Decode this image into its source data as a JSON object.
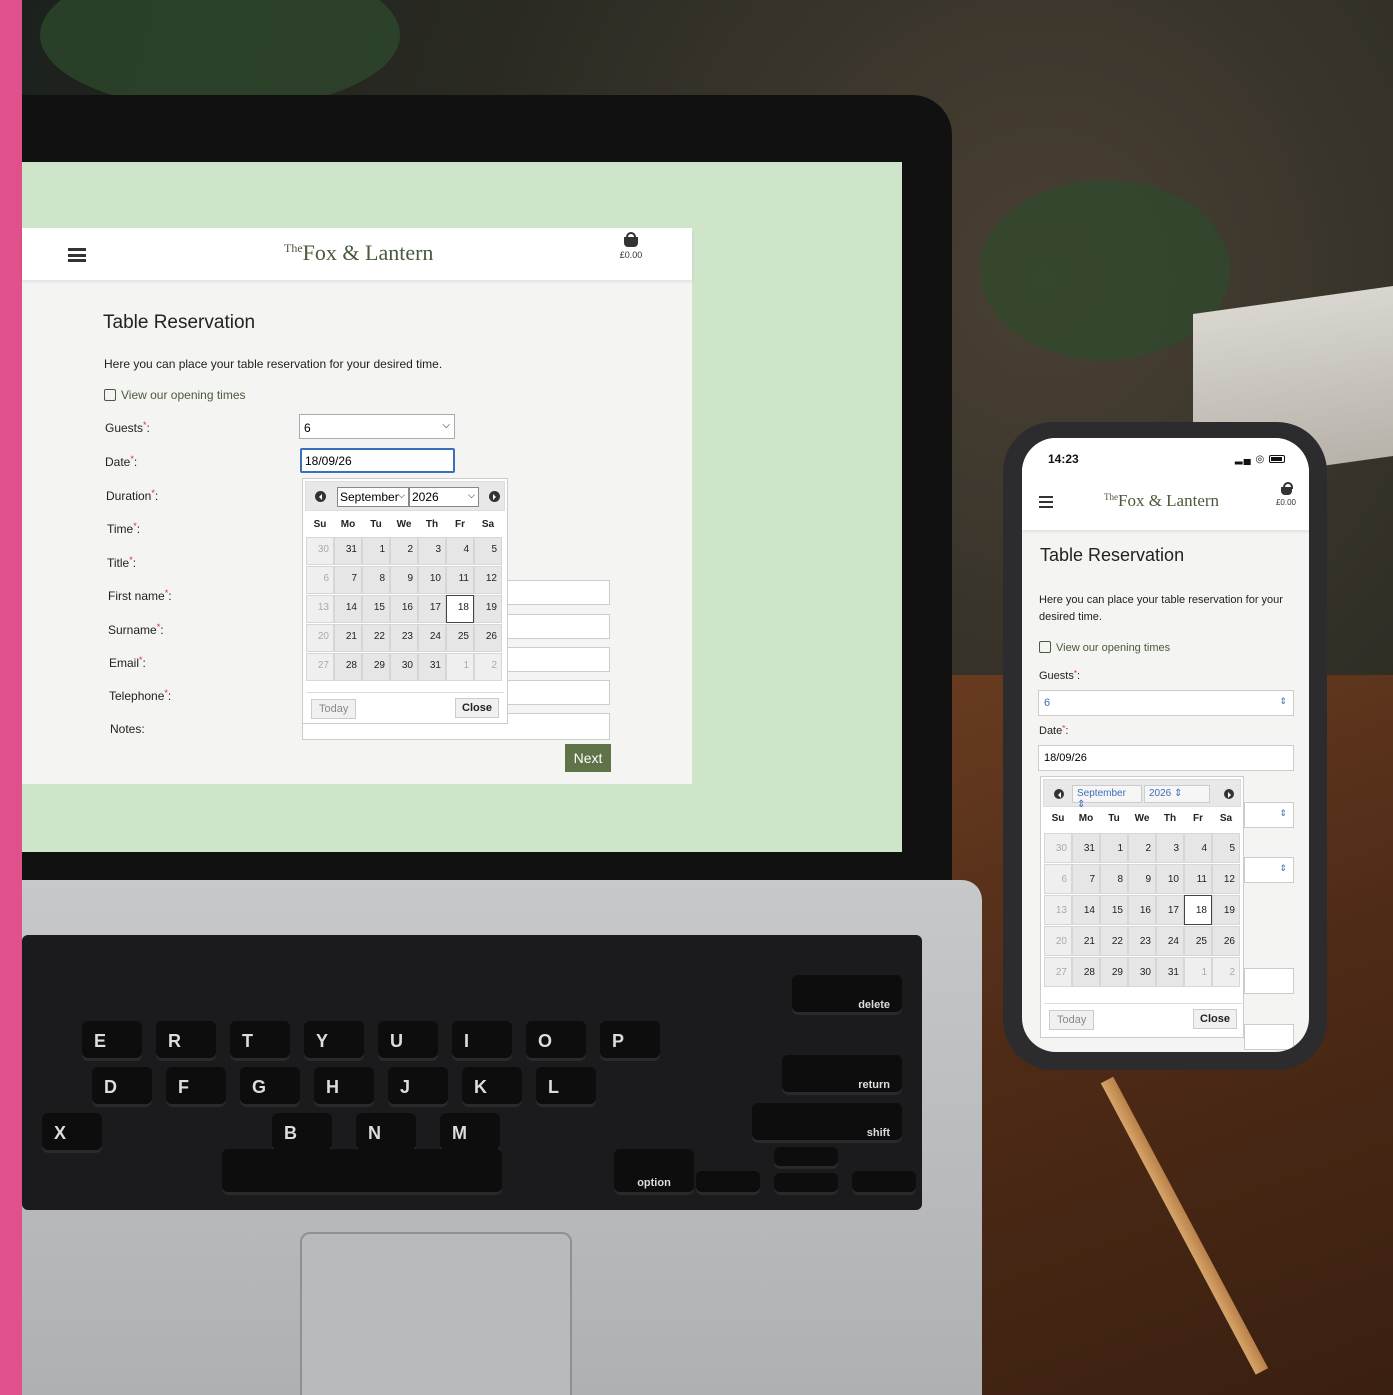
{
  "brand": {
    "the": "The",
    "name": "Fox & Lantern",
    "basket_total": "£0.00"
  },
  "page": {
    "title": "Table Reservation",
    "intro": "Here you can place your table reservation for your desired time.",
    "opening_link": "View our opening times",
    "next_label": "Next"
  },
  "form": {
    "guests_label": "Guests",
    "date_label": "Date",
    "duration_label": "Duration",
    "time_label": "Time",
    "title_label": "Title",
    "firstname_label": "First name",
    "surname_label": "Surname",
    "email_label": "Email",
    "telephone_label": "Telephone",
    "notes_label": "Notes:",
    "required_mark": "*",
    "colon": ":",
    "guests_value": "6",
    "date_value": "18/09/26"
  },
  "datepicker": {
    "month": "September",
    "year": "2026",
    "weekdays": [
      "Su",
      "Mo",
      "Tu",
      "We",
      "Th",
      "Fr",
      "Sa"
    ],
    "weeks": [
      [
        "30",
        "31",
        "1",
        "2",
        "3",
        "4",
        "5"
      ],
      [
        "6",
        "7",
        "8",
        "9",
        "10",
        "11",
        "12"
      ],
      [
        "13",
        "14",
        "15",
        "16",
        "17",
        "18",
        "19"
      ],
      [
        "20",
        "21",
        "22",
        "23",
        "24",
        "25",
        "26"
      ],
      [
        "27",
        "28",
        "29",
        "30",
        "31",
        "1",
        "2"
      ]
    ],
    "muted_days": [
      "0-0",
      "1-0",
      "2-0",
      "3-0",
      "4-0",
      "4-5",
      "4-6"
    ],
    "selected_day": "2-5",
    "today_label": "Today",
    "close_label": "Close"
  },
  "phone": {
    "time": "14:23",
    "intro": "Here you can place your table reservation for your desired time."
  },
  "keys": [
    "E",
    "R",
    "T",
    "Y",
    "U",
    "I",
    "O",
    "P",
    "D",
    "F",
    "G",
    "H",
    "J",
    "K",
    "L",
    "X",
    "B",
    "N",
    "M",
    "option",
    "shift",
    "return",
    "delete"
  ],
  "colors": {
    "accent": "#5e7348",
    "brand_text": "#4a5a3c",
    "focus": "#3b6fb8",
    "strip": "#e0508a",
    "backdrop": "#cfe5c9"
  }
}
